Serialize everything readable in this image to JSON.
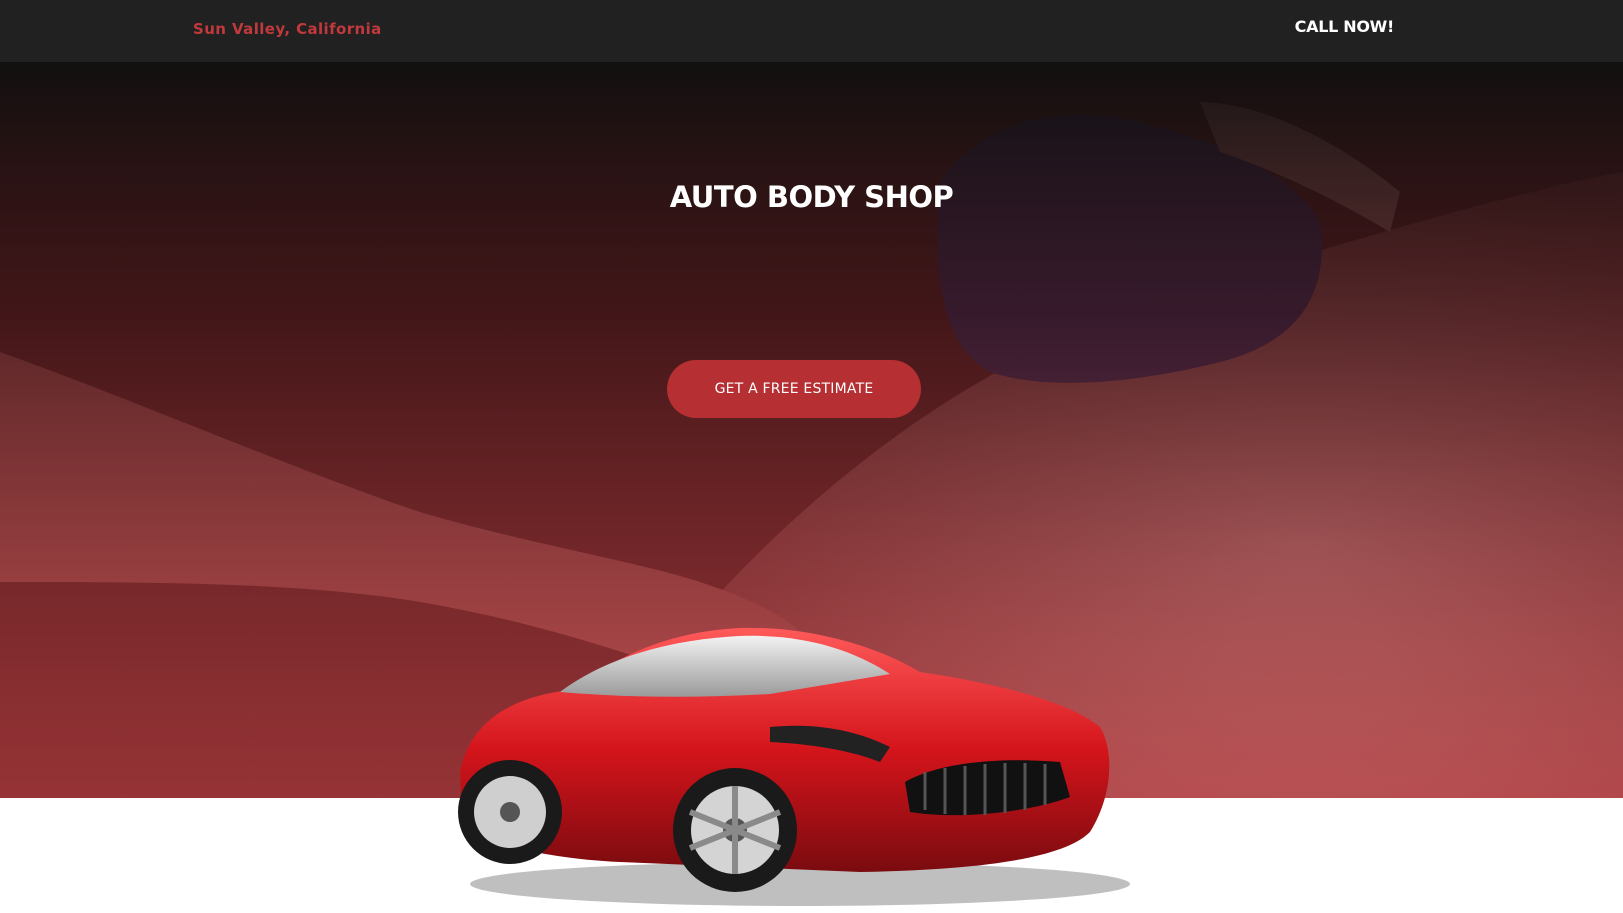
{
  "header": {
    "location": "Sun Valley, California",
    "cta_label": "CALL NOW!"
  },
  "hero": {
    "title": "AUTO BODY SHOP",
    "button_label": "GET A FREE ESTIMATE"
  },
  "colors": {
    "header_bg": "#212121",
    "accent_red": "#b62f33",
    "location_text": "#c0393c",
    "text_white": "#ffffff",
    "page_bg": "#ffffff"
  },
  "icons": {
    "car": "red-sports-car-image",
    "hero_photo": "hands-sanding-car-panel-photo"
  }
}
